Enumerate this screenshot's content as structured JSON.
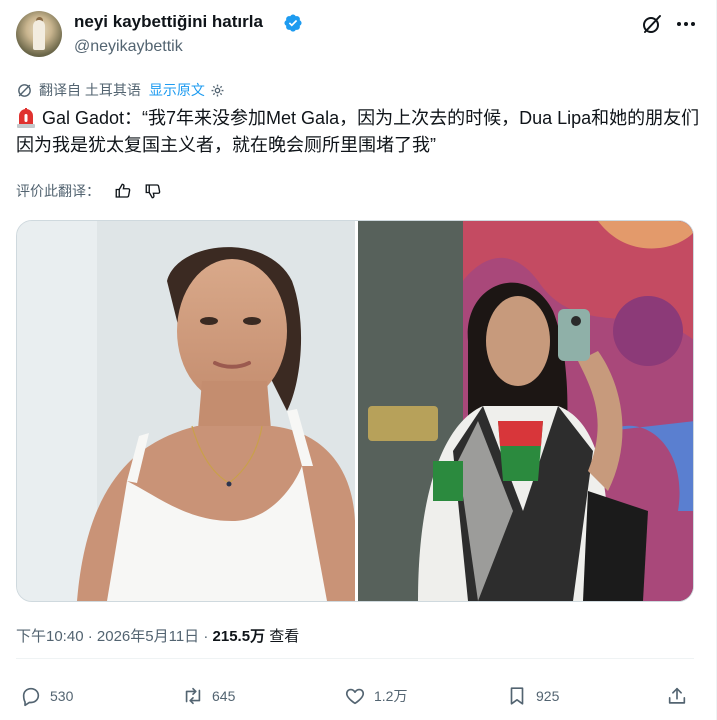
{
  "author": {
    "display_name": "neyi kaybettiğini hatırla",
    "handle": "@neyikaybettik",
    "verified": true,
    "avatar_icon": "avatar-image"
  },
  "translation": {
    "translated_from": "翻译自 土耳其语",
    "show_original": "显示原文"
  },
  "tweet": {
    "emoji": "rotating-light-icon",
    "text": "Gal Gadot：“我7年来没参加Met Gala，因为上次去的时候，Dua Lipa和她的朋友们因为我是犹太复国主义者，就在晚会厕所里围堵了我”"
  },
  "rating": {
    "label": "评价此翻译："
  },
  "media": [
    {
      "icon": "photo-woman-white-tank-top"
    },
    {
      "icon": "photo-woman-mirror-selfie"
    }
  ],
  "meta": {
    "time": "下午10:40",
    "date": "2026年5月11日",
    "views": "215.5万",
    "views_label": "查看"
  },
  "actions": {
    "replies": "530",
    "reposts": "645",
    "likes": "1.2万",
    "bookmarks": "925"
  },
  "colors": {
    "accent": "#1d9bf0",
    "secondary_text": "#536471",
    "primary_text": "#0f1419",
    "border": "#cfd9de"
  }
}
